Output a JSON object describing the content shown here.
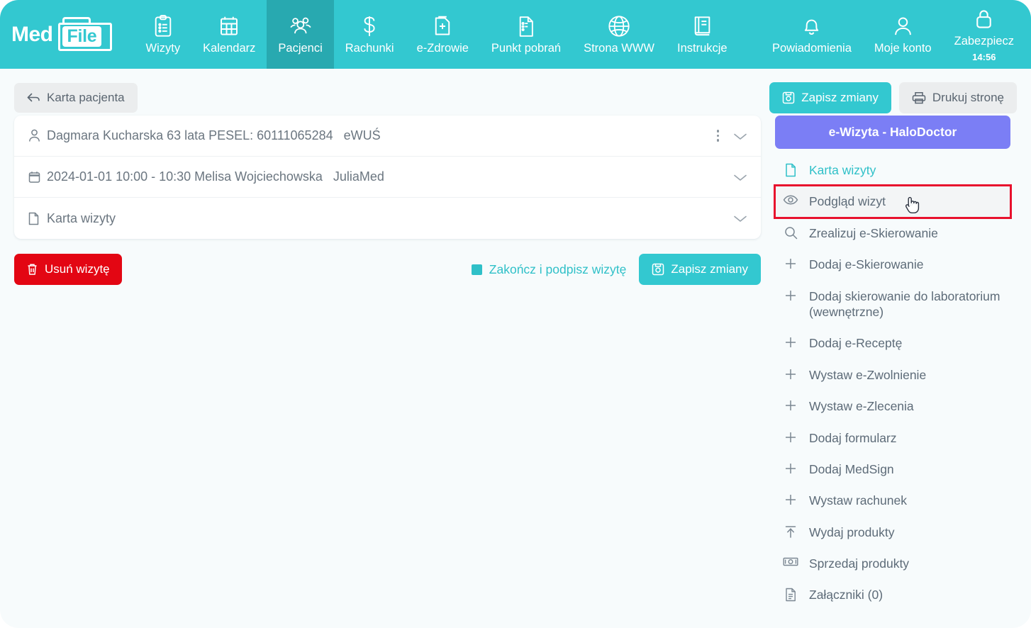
{
  "app": {
    "brand_prefix": "Med",
    "brand_suffix": "File"
  },
  "topnav": {
    "items": [
      {
        "label": "Wizyty",
        "icon": "clipboard-icon",
        "active": false
      },
      {
        "label": "Kalendarz",
        "icon": "calendar-icon",
        "active": false
      },
      {
        "label": "Pacjenci",
        "icon": "patients-icon",
        "active": true
      },
      {
        "label": "Rachunki",
        "icon": "dollar-icon",
        "active": false
      },
      {
        "label": "e-Zdrowie",
        "icon": "health-card-icon",
        "active": false
      },
      {
        "label": "Punkt pobrań",
        "icon": "document-lab-icon",
        "active": false
      },
      {
        "label": "Strona WWW",
        "icon": "globe-icon",
        "active": false
      },
      {
        "label": "Instrukcje",
        "icon": "book-icon",
        "active": false
      }
    ],
    "right_items": [
      {
        "label": "Powiadomienia",
        "icon": "bell-icon",
        "sub": ""
      },
      {
        "label": "Moje konto",
        "icon": "user-icon",
        "sub": ""
      },
      {
        "label": "Zabezpiecz",
        "icon": "lock-icon",
        "sub": "14:56"
      }
    ],
    "active_bg": "#28a9b0",
    "bg": "#33c8d0"
  },
  "toolbar": {
    "back_label": "Karta pacjenta",
    "save_label": "Zapisz zmiany",
    "print_label": "Drukuj stronę"
  },
  "visit_card": {
    "rows": [
      {
        "icon": "person-icon",
        "primary": "Dagmara Kucharska 63 lata PESEL: 60111065284",
        "secondary": "eWUŚ",
        "has_kebab": true,
        "has_chevron": true
      },
      {
        "icon": "calendar-icon",
        "primary": "2024-01-01 10:00 - 10:30   Melisa Wojciechowska",
        "secondary": "JuliaMed",
        "has_kebab": false,
        "has_chevron": true
      },
      {
        "icon": "file-icon",
        "primary": "Karta wizyty",
        "secondary": "",
        "has_kebab": false,
        "has_chevron": true
      }
    ]
  },
  "actions": {
    "delete_label": "Usuń wizytę",
    "finish_label": "Zakończ i podpisz wizytę",
    "save_label": "Zapisz zmiany"
  },
  "sidebar": {
    "header_label": "e-Wizyta - HaloDoctor",
    "header_color": "#7b7ef5",
    "highlight_color": "#e8112d",
    "items": [
      {
        "label": "Karta wizyty",
        "icon": "file-icon",
        "style": "teal",
        "highlighted": false
      },
      {
        "label": "Podgląd wizyt",
        "icon": "eye-icon",
        "style": "normal",
        "highlighted": true
      },
      {
        "label": "Zrealizuj e-Skierowanie",
        "icon": "search-icon",
        "style": "normal",
        "highlighted": false
      },
      {
        "label": "Dodaj e-Skierowanie",
        "icon": "plus-icon",
        "style": "normal",
        "highlighted": false
      },
      {
        "label": "Dodaj skierowanie do laboratorium (wewnętrzne)",
        "icon": "plus-icon",
        "style": "normal",
        "highlighted": false
      },
      {
        "label": "Dodaj e-Receptę",
        "icon": "plus-icon",
        "style": "normal",
        "highlighted": false
      },
      {
        "label": "Wystaw e-Zwolnienie",
        "icon": "plus-icon",
        "style": "normal",
        "highlighted": false
      },
      {
        "label": "Wystaw e-Zlecenia",
        "icon": "plus-icon",
        "style": "normal",
        "highlighted": false
      },
      {
        "label": "Dodaj formularz",
        "icon": "plus-icon",
        "style": "normal",
        "highlighted": false
      },
      {
        "label": "Dodaj MedSign",
        "icon": "plus-icon",
        "style": "normal",
        "highlighted": false
      },
      {
        "label": "Wystaw rachunek",
        "icon": "plus-icon",
        "style": "normal",
        "highlighted": false
      },
      {
        "label": "Wydaj produkty",
        "icon": "arrow-up-bar-icon",
        "style": "normal",
        "highlighted": false
      },
      {
        "label": "Sprzedaj produkty",
        "icon": "banknote-icon",
        "style": "normal",
        "highlighted": false
      },
      {
        "label": "Załączniki (0)",
        "icon": "attachment-doc-icon",
        "style": "normal",
        "highlighted": false
      }
    ]
  }
}
